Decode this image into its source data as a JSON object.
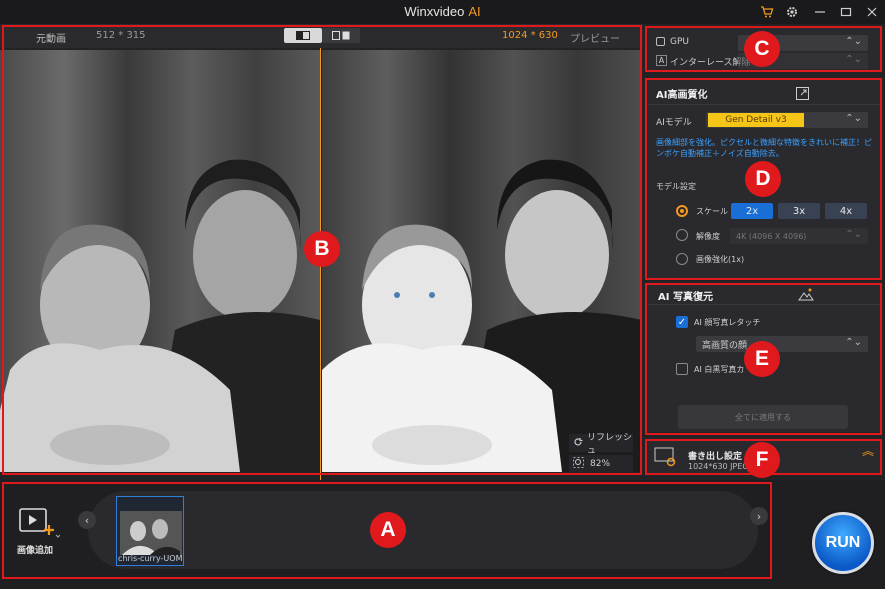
{
  "app": {
    "title": "Winxvideo",
    "title_ai": "AI"
  },
  "preview": {
    "original_label": "元動画",
    "original_size": "512 * 315",
    "output_size": "1024 * 630",
    "preview_label": "プレビュー",
    "refresh_label": "リフレッシュ",
    "zoom": "82%"
  },
  "hardware": {
    "gpu_label": "GPU",
    "deinterlace_label": "インターレース解除"
  },
  "ai_enhance": {
    "title": "AI高画質化",
    "model_label": "AIモデル",
    "model_value": "Gen Detail v3",
    "description": "画像細部を強化。ピクセルと微細な特徴をきれいに補正！ピンボケ自動補正＋ノイズ自動除去。",
    "model_settings_label": "モデル設定",
    "scale_label": "スケール",
    "scale_options": [
      "2x",
      "3x",
      "4x"
    ],
    "resolution_label": "解像度",
    "resolution_value": "4K (4096 X 4096)",
    "enhance_label": "画像強化(1x)"
  },
  "ai_restore": {
    "title": "AI 写真復元",
    "face_label": "AI 顔写真レタッチ",
    "face_option": "高画質の顔",
    "colorize_label": "AI 白黒写真カ",
    "apply_all_label": "全てに適用する"
  },
  "export": {
    "title": "書き出し設定",
    "info": "1024*630 JPEG"
  },
  "bottom": {
    "add_image_label": "画像追加",
    "thumbnail_name": "chris-curry-UOM",
    "run_label": "RUN"
  },
  "annotations": {
    "A": "A",
    "B": "B",
    "C": "C",
    "D": "D",
    "E": "E",
    "F": "F"
  },
  "colors": {
    "accent": "#f39a1e",
    "annotation": "#e0191d",
    "primary_blue": "#1a6fd6",
    "model_yellow": "#f5c518"
  }
}
